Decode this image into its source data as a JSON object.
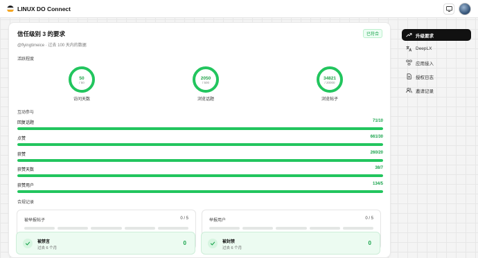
{
  "app": {
    "title": "LINUX DO Connect"
  },
  "card": {
    "title": "信任级别 3 的要求",
    "badge": "已符合",
    "subtitle": "@flyingtimeice · 过去 100 天内的数据"
  },
  "activity": {
    "label": "活跃程度",
    "rings": [
      {
        "value": "50",
        "target": "/ 50",
        "label": "访问天数",
        "progress": 1.0
      },
      {
        "value": "2050",
        "target": "/ 500",
        "label": "浏览话题",
        "progress": 1.0
      },
      {
        "value": "34821",
        "target": "/ 20000",
        "label": "浏览帖子",
        "progress": 1.0
      }
    ]
  },
  "interaction": {
    "label": "互动参与",
    "bars": [
      {
        "label": "回复话题",
        "value": "71/10",
        "progress": 1.0
      },
      {
        "label": "点赞",
        "value": "661/30",
        "progress": 1.0
      },
      {
        "label": "获赞",
        "value": "260/20",
        "progress": 1.0
      },
      {
        "label": "获赞天数",
        "value": "38/7",
        "progress": 1.0
      },
      {
        "label": "获赞用户",
        "value": "134/5",
        "progress": 1.0
      }
    ]
  },
  "compliance": {
    "label": "合规记录",
    "reports": [
      {
        "label": "被举报帖子",
        "value": "0 / 5"
      },
      {
        "label": "举报用户",
        "value": "0 / 5"
      }
    ],
    "status": [
      {
        "title": "被禁言",
        "sub": "过去 6 个月",
        "value": "0"
      },
      {
        "title": "被封禁",
        "sub": "过去 6 个月",
        "value": "0"
      }
    ]
  },
  "sidebar": {
    "items": [
      {
        "label": "升级要求",
        "icon": "trending-up-icon",
        "active": true
      },
      {
        "label": "DeepLX",
        "icon": "translate-icon",
        "active": false
      },
      {
        "label": "应用接入",
        "icon": "apps-icon",
        "active": false
      },
      {
        "label": "授权日志",
        "icon": "document-icon",
        "active": false
      },
      {
        "label": "邀请记录",
        "icon": "users-icon",
        "active": false
      }
    ]
  },
  "colors": {
    "accent": "#22c55e",
    "accent_text": "#16a34a",
    "track": "#dff5e6",
    "active_bg": "#111111"
  }
}
